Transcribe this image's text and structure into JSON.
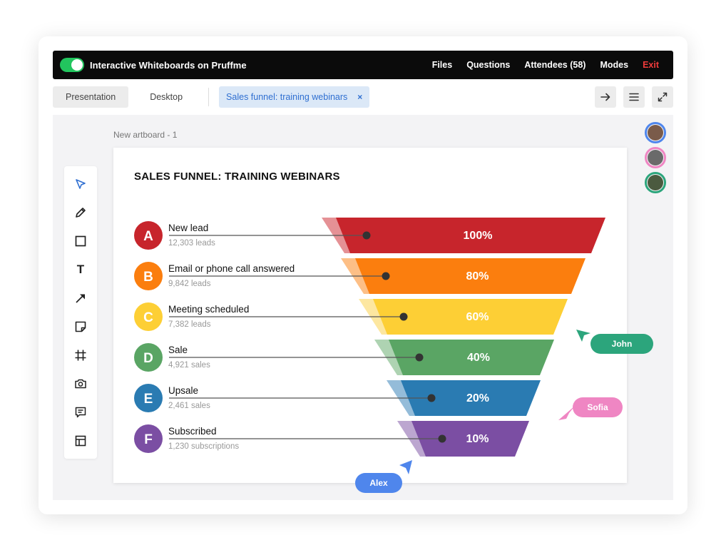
{
  "app": {
    "title": "Interactive Whiteboards on Pruffme",
    "nav": [
      "Files",
      "Questions",
      "Attendees (58)",
      "Modes",
      "Exit"
    ]
  },
  "tabs": {
    "presentation": "Presentation",
    "desktop": "Desktop",
    "document": "Sales funnel: training webinars",
    "close": "×"
  },
  "icons": {
    "next": "arrow-right-icon",
    "menu": "menu-icon",
    "fullscreen": "fullscreen-icon"
  },
  "artboard": {
    "label": "New artboard - 1",
    "title": "SALES FUNNEL: TRAINING WEBINARS"
  },
  "tools": [
    "select-tool",
    "pencil-tool",
    "rectangle-tool",
    "text-tool",
    "arrow-tool",
    "sticky-note-tool",
    "frame-tool",
    "camera-tool",
    "comment-tool",
    "layout-tool"
  ],
  "text_tool_glyph": "T",
  "funnel": {
    "stages": [
      {
        "letter": "A",
        "title": "New lead",
        "sub": "12,303 leads",
        "percent": "100%",
        "color": "#c7252c"
      },
      {
        "letter": "B",
        "title": "Email or phone call answered",
        "sub": "9,842 leads",
        "percent": "80%",
        "color": "#fb7e0e"
      },
      {
        "letter": "C",
        "title": "Meeting scheduled",
        "sub": "7,382 leads",
        "percent": "60%",
        "color": "#fdcf35"
      },
      {
        "letter": "D",
        "title": "Sale",
        "sub": "4,921 sales",
        "percent": "40%",
        "color": "#5aa564"
      },
      {
        "letter": "E",
        "title": "Upsale",
        "sub": "2,461 sales",
        "percent": "20%",
        "color": "#2a7bb2"
      },
      {
        "letter": "F",
        "title": "Subscribed",
        "sub": "1,230 subscriptions",
        "percent": "10%",
        "color": "#7b4ea3"
      }
    ]
  },
  "cursors": [
    {
      "name": "John",
      "color": "#2ca57c"
    },
    {
      "name": "Sofia",
      "color": "#ef86c3"
    },
    {
      "name": "Alex",
      "color": "#4f86ec"
    }
  ],
  "avatars": [
    {
      "border": "#4f86ec",
      "face": "#7a5b4a"
    },
    {
      "border": "#ef86c3",
      "face": "#6a6a6a"
    },
    {
      "border": "#2ca57c",
      "face": "#4b5a3f"
    }
  ]
}
